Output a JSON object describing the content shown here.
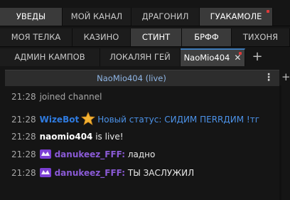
{
  "tabs": {
    "row1": [
      {
        "label": "УВЕДЫ",
        "dot": false
      },
      {
        "label": "МОЙ КАНАЛ",
        "dot": false
      },
      {
        "label": "ДРАГОНИЛ",
        "dot": false
      },
      {
        "label": "ГУАКАМОЛЕ",
        "dot": true
      }
    ],
    "row2": [
      {
        "label": "МОЯ ТЕЛКА"
      },
      {
        "label": "КАЗИНО"
      },
      {
        "label": "СТИНТ"
      },
      {
        "label": "БРФФ"
      },
      {
        "label": "ТИХОНЯ"
      }
    ],
    "row3": [
      {
        "label": "АДМИН КАМПОВ"
      },
      {
        "label": "ЛОКАЛЯН ГЕЙ"
      },
      {
        "label": "NaoMio404",
        "selected": true,
        "dot": true,
        "close": "✕"
      }
    ],
    "add_tab": "+"
  },
  "channel_header": {
    "title": "NaoMio404 (live)",
    "menu_icon": "⋮",
    "add_split": "+"
  },
  "messages": [
    {
      "time": "21:28",
      "system": "joined channel"
    },
    {
      "time": "21:28",
      "badge": "star",
      "user": "WizeBot",
      "user_color": "#2f7be0",
      "text": "Новый статус: СИДИМ ПЕRRДИМ !тг",
      "text_color": "#4c92e8"
    },
    {
      "time": "21:28",
      "user": "naomio404",
      "user_color": "#ffffff",
      "text": "is live!"
    },
    {
      "time": "21:28",
      "badge": "dank",
      "user": "danukeez_FFF:",
      "user_color": "#8a5ad6",
      "text": "ладно"
    },
    {
      "time": "21:28",
      "badge": "dank",
      "user": "danukeez_FFF:",
      "user_color": "#8a5ad6",
      "text": "ТЫ ЗАСЛУЖИЛ"
    }
  ],
  "colors": {
    "selected_tab_accent": "#3d7ab8",
    "header_title": "#8fb6e6",
    "unread_dot": "#e03a3a"
  }
}
